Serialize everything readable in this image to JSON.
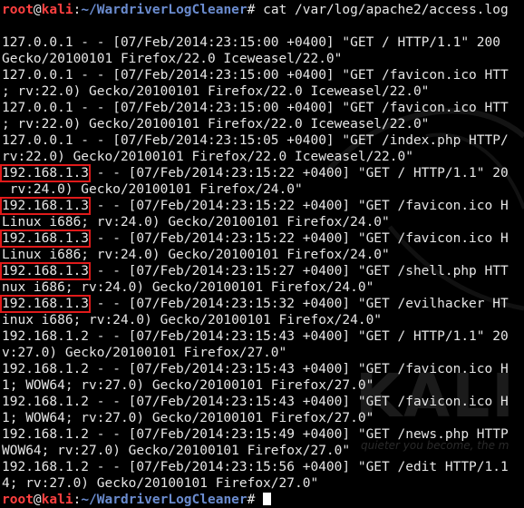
{
  "prompt": {
    "user": "root",
    "at": "@",
    "host": "kali",
    "sep": ":",
    "path": "~/WardriverLogCleaner",
    "symbol": "#"
  },
  "command": " cat /var/log/apache2/access.log",
  "log_lines": [
    {
      "text": "127.0.0.1 - - [07/Feb/2014:23:15:00 +0400] \"GET / HTTP/1.1\" 200"
    },
    {
      "text": "Gecko/20100101 Firefox/22.0 Iceweasel/22.0\""
    },
    {
      "text": "127.0.0.1 - - [07/Feb/2014:23:15:00 +0400] \"GET /favicon.ico HTT"
    },
    {
      "text": "; rv:22.0) Gecko/20100101 Firefox/22.0 Iceweasel/22.0\""
    },
    {
      "text": "127.0.0.1 - - [07/Feb/2014:23:15:00 +0400] \"GET /favicon.ico HTT"
    },
    {
      "text": "; rv:22.0) Gecko/20100101 Firefox/22.0 Iceweasel/22.0\""
    },
    {
      "text": "127.0.0.1 - - [07/Feb/2014:23:15:05 +0400] \"GET /index.php HTTP/"
    },
    {
      "text": "rv:22.0) Gecko/20100101 Firefox/22.0 Iceweasel/22.0\""
    },
    {
      "ip": "192.168.1.3",
      "text": " - - [07/Feb/2014:23:15:22 +0400] \"GET / HTTP/1.1\" 20"
    },
    {
      "text": " rv:24.0) Gecko/20100101 Firefox/24.0\""
    },
    {
      "ip": "192.168.1.3",
      "text": " - - [07/Feb/2014:23:15:22 +0400] \"GET /favicon.ico H"
    },
    {
      "text": "Linux i686; rv:24.0) Gecko/20100101 Firefox/24.0\""
    },
    {
      "ip": "192.168.1.3",
      "text": " - - [07/Feb/2014:23:15:22 +0400] \"GET /favicon.ico H"
    },
    {
      "text": "Linux i686; rv:24.0) Gecko/20100101 Firefox/24.0\""
    },
    {
      "ip": "192.168.1.3",
      "text": " - - [07/Feb/2014:23:15:27 +0400] \"GET /shell.php HTT"
    },
    {
      "text": "nux i686; rv:24.0) Gecko/20100101 Firefox/24.0\""
    },
    {
      "ip": "192.168.1.3",
      "text": " - - [07/Feb/2014:23:15:32 +0400] \"GET /evilhacker HT"
    },
    {
      "text": "inux i686; rv:24.0) Gecko/20100101 Firefox/24.0\""
    },
    {
      "text": "192.168.1.2 - - [07/Feb/2014:23:15:43 +0400] \"GET / HTTP/1.1\" 20"
    },
    {
      "text": "v:27.0) Gecko/20100101 Firefox/27.0\""
    },
    {
      "text": "192.168.1.2 - - [07/Feb/2014:23:15:43 +0400] \"GET /favicon.ico H"
    },
    {
      "text": "1; WOW64; rv:27.0) Gecko/20100101 Firefox/27.0\""
    },
    {
      "text": "192.168.1.2 - - [07/Feb/2014:23:15:43 +0400] \"GET /favicon.ico H"
    },
    {
      "text": "1; WOW64; rv:27.0) Gecko/20100101 Firefox/27.0\""
    },
    {
      "text": "192.168.1.2 - - [07/Feb/2014:23:15:49 +0400] \"GET /news.php HTTP"
    },
    {
      "text": "WOW64; rv:27.0) Gecko/20100101 Firefox/27.0\""
    },
    {
      "text": "192.168.1.2 - - [07/Feb/2014:23:15:56 +0400] \"GET /edit HTTP/1.1"
    },
    {
      "text": "4; rv:27.0) Gecko/20100101 Firefox/27.0\""
    }
  ],
  "wallpaper": {
    "logo_text": "KALI LI",
    "tagline": "quieter you become, the m"
  },
  "colors": {
    "background": "#000000",
    "text": "#e6e6e6",
    "prompt_user": "#ff4040",
    "prompt_path": "#6b8ccf",
    "highlight_box": "#e01a1a"
  }
}
